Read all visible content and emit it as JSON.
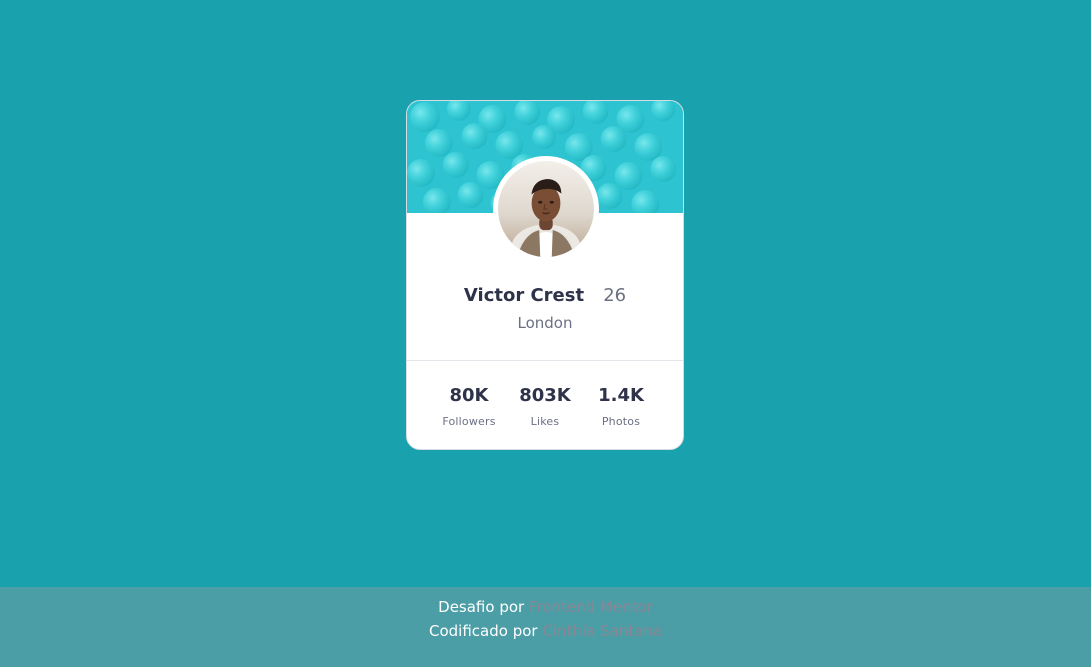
{
  "profile": {
    "name": "Victor Crest",
    "age": "26",
    "city": "London"
  },
  "stats": [
    {
      "value": "80K",
      "label": "Followers"
    },
    {
      "value": "803K",
      "label": "Likes"
    },
    {
      "value": "1.4K",
      "label": "Photos"
    }
  ],
  "footer": {
    "line1_prefix": "Desafio por",
    "line1_link": "Frontend Mentor",
    "line2_prefix": "Codificado por",
    "line2_link": "Cinthia Santana"
  },
  "colors": {
    "page_background": "#19a2ae",
    "card_header": "#2dc3d0",
    "footer_background": "#4b9ea6",
    "text_dark": "#2e3349",
    "text_muted": "#6b7082",
    "footer_link": "#888795"
  },
  "icons": {
    "header_pattern": "bubble-pattern",
    "avatar": "profile-photo"
  }
}
